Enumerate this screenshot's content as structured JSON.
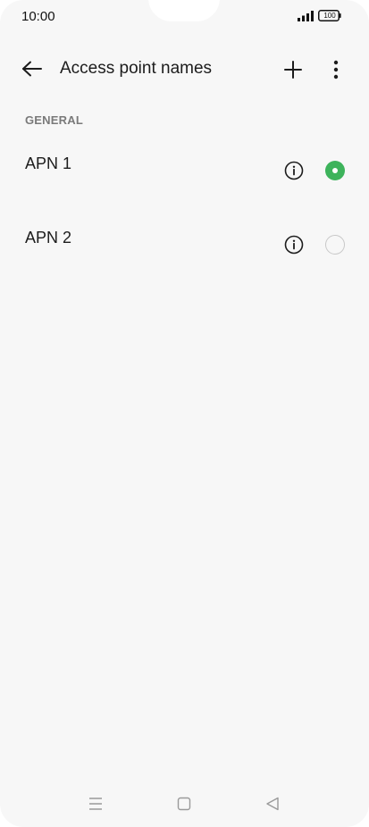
{
  "status_bar": {
    "time": "10:00",
    "battery": "100"
  },
  "header": {
    "title": "Access point names"
  },
  "section": {
    "label": "GENERAL"
  },
  "apns": [
    {
      "name": "APN 1",
      "selected": true
    },
    {
      "name": "APN 2",
      "selected": false
    }
  ],
  "colors": {
    "accent": "#3db35b",
    "background": "#f7f7f7",
    "section_label": "#7a7a7a"
  },
  "icons": {
    "back": "arrow-left-icon",
    "add": "plus-icon",
    "more": "more-vertical-icon",
    "info": "info-icon",
    "nav_recents": "menu-lines-icon",
    "nav_home": "square-icon",
    "nav_back": "triangle-left-icon"
  }
}
